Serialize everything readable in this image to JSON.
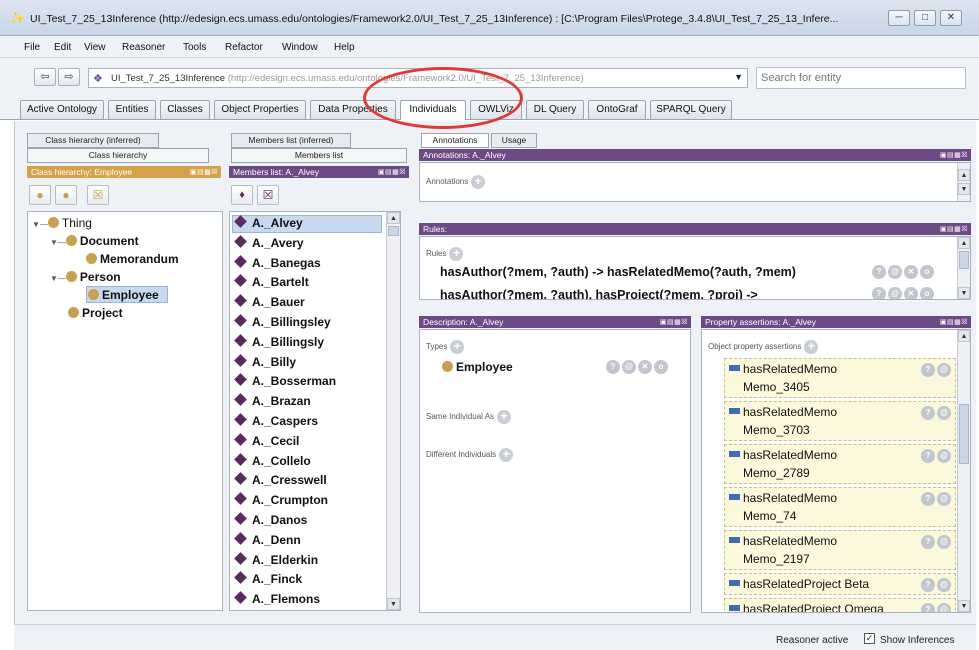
{
  "window": {
    "title": "UI_Test_7_25_13Inference (http://edesign.ecs.umass.edu/ontologies/Framework2.0/UI_Test_7_25_13Inference) : [C:\\Program Files\\Protege_3.4.8\\UI_Test_7_25_13_Infere..."
  },
  "menu": [
    "File",
    "Edit",
    "View",
    "Reasoner",
    "Tools",
    "Refactor",
    "Window",
    "Help"
  ],
  "nav": {
    "ontology_name": "UI_Test_7_25_13Inference",
    "ontology_iri": "(http://edesign.ecs.umass.edu/ontologies/Framework2.0/UI_Test_7_25_13Inference)",
    "search_placeholder": "Search for entity"
  },
  "tabs": [
    "Active Ontology",
    "Entities",
    "Classes",
    "Object Properties",
    "Data Properties",
    "Individuals",
    "OWLViz",
    "DL Query",
    "OntoGraf",
    "SPARQL Query"
  ],
  "active_tab": "Individuals",
  "class_panel": {
    "subtab_inferred": "Class hierarchy (inferred)",
    "subtab": "Class hierarchy",
    "header": "Class hierarchy: Employee",
    "tree": {
      "thing": "Thing",
      "document": "Document",
      "memorandum": "Memorandum",
      "person": "Person",
      "employee": "Employee",
      "project": "Project"
    }
  },
  "members_panel": {
    "subtab_inferred": "Members list (inferred)",
    "subtab": "Members list",
    "header": "Members list: A._Alvey",
    "members": [
      "A._Alvey",
      "A._Avery",
      "A._Banegas",
      "A._Bartelt",
      "A._Bauer",
      "A._Billingsley",
      "A._Billingsly",
      "A._Billy",
      "A._Bosserman",
      "A._Brazan",
      "A._Caspers",
      "A._Cecil",
      "A._Collelo",
      "A._Cresswell",
      "A._Crumpton",
      "A._Danos",
      "A._Denn",
      "A._Elderkin",
      "A._Finck",
      "A._Flemons"
    ]
  },
  "annotations_panel": {
    "tab_annotations": "Annotations",
    "tab_usage": "Usage",
    "header": "Annotations: A._Alvey",
    "label": "Annotations"
  },
  "rules_panel": {
    "header": "Rules:",
    "label": "Rules",
    "rules": [
      "hasAuthor(?mem, ?auth) -> hasRelatedMemo(?auth, ?mem)",
      "hasAuthor(?mem, ?auth), hasProject(?mem, ?proj) ->"
    ]
  },
  "description_panel": {
    "header": "Description: A._Alvey",
    "types_label": "Types",
    "type_value": "Employee",
    "same_label": "Same Individual As",
    "different_label": "Different Individuals"
  },
  "property_panel": {
    "header": "Property assertions: A._Alvey",
    "label": "Object property assertions",
    "assertions": [
      {
        "property": "hasRelatedMemo",
        "value": "Memo_3405"
      },
      {
        "property": "hasRelatedMemo",
        "value": "Memo_3703"
      },
      {
        "property": "hasRelatedMemo",
        "value": "Memo_2789"
      },
      {
        "property": "hasRelatedMemo",
        "value": "Memo_74"
      },
      {
        "property": "hasRelatedMemo",
        "value": "Memo_2197"
      }
    ],
    "inline_assertions": [
      {
        "property": "hasRelatedProject",
        "value": "Beta"
      },
      {
        "property": "hasRelatedProject",
        "value": "Omega"
      }
    ]
  },
  "status": {
    "reasoner": "Reasoner active",
    "show_inferences": "Show Inferences"
  },
  "colors": {
    "class_header": "#d5a24a",
    "individual_header": "#6c4a85",
    "highlight_circle": "#e03a36"
  }
}
